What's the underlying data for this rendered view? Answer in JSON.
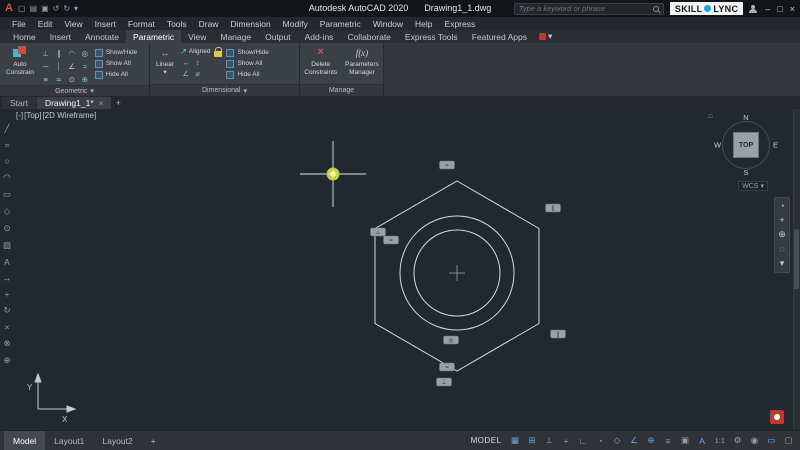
{
  "title_bar": {
    "logo_letter": "A",
    "qat": {
      "new": "▢",
      "open": "▤",
      "save": "▣",
      "undo": "↺",
      "redo": "↻",
      "dropdown": "▾"
    },
    "app_title": "Autodesk AutoCAD 2020",
    "doc_title": "Drawing1_1.dwg",
    "search_placeholder": "Type a keyword or phrase",
    "brand_skill": "SKILL",
    "brand_lync": "LYNC",
    "min": "–",
    "max": "□",
    "close": "×"
  },
  "menu_bar": {
    "items": [
      "File",
      "Edit",
      "View",
      "Insert",
      "Format",
      "Tools",
      "Draw",
      "Dimension",
      "Modify",
      "Parametric",
      "Window",
      "Help",
      "Express"
    ]
  },
  "ribbon_tabs": {
    "items": [
      "Home",
      "Insert",
      "Annotate",
      "Parametric",
      "View",
      "Manage",
      "Output",
      "Add-ins",
      "Collaborate",
      "Express Tools",
      "Featured Apps"
    ],
    "overflow": "▾"
  },
  "ribbon": {
    "geometric": {
      "auto1": "Auto",
      "auto2": "Constrain",
      "grid": [
        "⊥",
        "∥",
        "◠",
        "◎",
        "─",
        "│",
        "∠",
        "=",
        "≡",
        "≃",
        "⊙",
        "⊕"
      ],
      "show_hide": "Show/Hide",
      "show_all": "Show All",
      "hide_all": "Hide All",
      "label": "Geometric",
      "caret": "▾"
    },
    "dimensional": {
      "linear": "Linear",
      "linear_icon": "↔",
      "caret": "▾",
      "aligned": "Aligned",
      "aligned_icon": "↗",
      "mini": [
        "↔",
        "↕",
        "∠",
        "⌀"
      ],
      "show_hide": "Show/Hide",
      "show_all": "Show All",
      "hide_all": "Hide All",
      "label": "Dimensional"
    },
    "manage": {
      "del_icon": "×",
      "del1": "Delete",
      "del2": "Constraints",
      "fx": "f(x)",
      "par1": "Parameters",
      "par2": "Manager",
      "label": "Manage"
    }
  },
  "file_tabs": {
    "start": "Start",
    "drawing": "Drawing1_1*",
    "close": "×",
    "add": "+"
  },
  "viewport": {
    "minus": "[-]",
    "view": "[Top]",
    "visual_style": "[2D Wireframe]"
  },
  "left_toolbar": {
    "icons": [
      "╱",
      "≈",
      "○",
      "◠",
      "▭",
      "◇",
      "⊙",
      "▨",
      "A",
      "↔",
      "+",
      "↻",
      "×",
      "⊗",
      "⊕"
    ]
  },
  "viewcube": {
    "n": "N",
    "w": "W",
    "e": "E",
    "s": "S",
    "face": "TOP",
    "home": "⌂",
    "wcs": "WCS",
    "caret": "▾"
  },
  "navbar": {
    "icons": [
      "◔",
      "+",
      "⊕",
      "◌",
      "▾"
    ]
  },
  "drawing": {
    "badges": [
      "=",
      "∥",
      "⊥",
      "=",
      "∥",
      "◎",
      "=",
      "⊥"
    ],
    "axis_x": "X",
    "axis_y": "Y"
  },
  "layout_tabs": {
    "model": "Model",
    "layout1": "Layout1",
    "layout2": "Layout2",
    "add": "+"
  },
  "status_bar": {
    "model_label": "MODEL",
    "icons": [
      "▦",
      "⊞",
      "⊥",
      "+",
      "∟",
      "◔",
      "◇",
      "∠",
      "⊕",
      "≡",
      "▣",
      "A",
      "1:1",
      "⚙",
      "◉",
      "▭",
      "▢"
    ]
  }
}
